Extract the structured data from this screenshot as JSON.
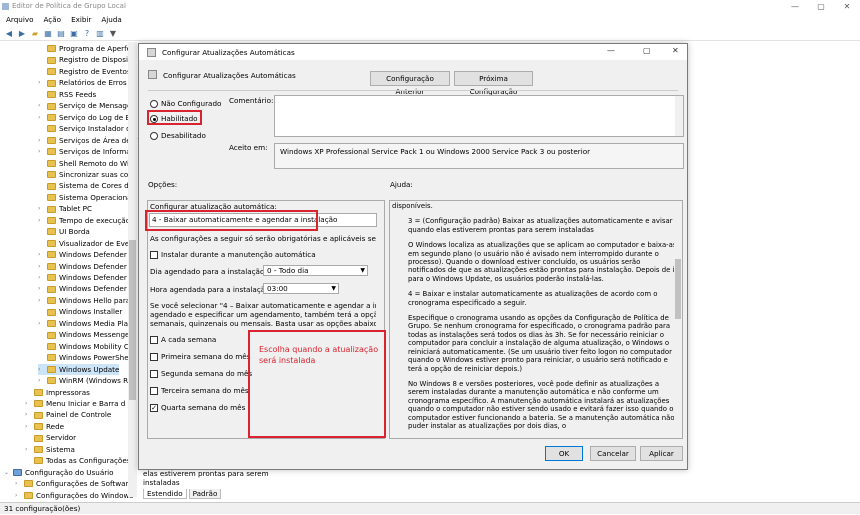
{
  "window": {
    "title": "Editor de Política de Grupo Local",
    "min": "—",
    "max": "▢",
    "close": "✕"
  },
  "menu": [
    "Arquivo",
    "Ação",
    "Exibir",
    "Ajuda"
  ],
  "tree": [
    {
      "label": "Programa de Aperfei",
      "indent": 3
    },
    {
      "label": "Registro de Disposit",
      "indent": 3
    },
    {
      "label": "Registro de Eventos",
      "indent": 3
    },
    {
      "label": "Relatórios de Erros d",
      "indent": 3,
      "expand": true
    },
    {
      "label": "RSS Feeds",
      "indent": 3
    },
    {
      "label": "Serviço de Mensager",
      "indent": 3,
      "expand": true
    },
    {
      "label": "Serviço do Log de Ev",
      "indent": 3,
      "expand": true
    },
    {
      "label": "Serviço Instalador do",
      "indent": 3
    },
    {
      "label": "Serviços de Área de T",
      "indent": 3,
      "expand": true
    },
    {
      "label": "Serviços de Informaç",
      "indent": 3,
      "expand": true
    },
    {
      "label": "Shell Remoto do Win",
      "indent": 3
    },
    {
      "label": "Sincronizar suas conf",
      "indent": 3
    },
    {
      "label": "Sistema de Cores do",
      "indent": 3
    },
    {
      "label": "Sistema Operacional",
      "indent": 3
    },
    {
      "label": "Tablet PC",
      "indent": 3,
      "expand": true
    },
    {
      "label": "Tempo de execução",
      "indent": 3,
      "expand": true
    },
    {
      "label": "UI Borda",
      "indent": 3
    },
    {
      "label": "Visualizador de Event",
      "indent": 3
    },
    {
      "label": "Windows Defender A",
      "indent": 3,
      "expand": true
    },
    {
      "label": "Windows Defender A",
      "indent": 3,
      "expand": true
    },
    {
      "label": "Windows Defender E",
      "indent": 3,
      "expand": true
    },
    {
      "label": "Windows Defender S",
      "indent": 3,
      "expand": true
    },
    {
      "label": "Windows Hello para l",
      "indent": 3,
      "expand": true
    },
    {
      "label": "Windows Installer",
      "indent": 3
    },
    {
      "label": "Windows Media Play",
      "indent": 3,
      "expand": true
    },
    {
      "label": "Windows Messenger",
      "indent": 3
    },
    {
      "label": "Windows Mobility Ce",
      "indent": 3
    },
    {
      "label": "Windows PowerShell",
      "indent": 3
    },
    {
      "label": "Windows Update",
      "indent": 3,
      "selected": true,
      "expand": true
    },
    {
      "label": "WinRM (Windows Re",
      "indent": 3,
      "expand": true
    },
    {
      "label": "Impressoras",
      "indent": 2
    },
    {
      "label": "Menu Iniciar e Barra d",
      "indent": 2,
      "expand": true
    },
    {
      "label": "Painel de Controle",
      "indent": 2,
      "expand": true
    },
    {
      "label": "Rede",
      "indent": 2,
      "expand": true
    },
    {
      "label": "Servidor",
      "indent": 2
    },
    {
      "label": "Sistema",
      "indent": 2,
      "expand": true
    },
    {
      "label": "Todas as Configurações",
      "indent": 2
    },
    {
      "label": "Configuração do Usuário",
      "indent": 0,
      "expand": true,
      "computer": true
    },
    {
      "label": "Configurações de Software",
      "indent": 1,
      "expand": true
    },
    {
      "label": "Configurações do Windows",
      "indent": 1,
      "expand": true
    },
    {
      "label": "Modelos Administrativos",
      "indent": 1,
      "expand": true
    }
  ],
  "behind": {
    "line1": "elas estiverem prontas para serem",
    "line2": "instaladas",
    "tab1": "Estendido",
    "tab2": "Padrão"
  },
  "status": "31 configuração(ões)",
  "dialog": {
    "title": "Configurar Atualizações Automáticas",
    "heading": "Configurar Atualizações Automáticas",
    "prev": "Configuração Anterior",
    "next": "Próxima Configuração",
    "radio_not": "Não Configurado",
    "radio_enabled": "Habilitado",
    "radio_disabled": "Desabilitado",
    "comment_label": "Comentário:",
    "supported_label": "Aceito em:",
    "supported_text": "Windows XP Professional Service Pack 1 ou Windows 2000 Service Pack 3 ou posterior",
    "options_label": "Opções:",
    "help_label": "Ajuda:",
    "opt_title": "Configurar atualização automática:",
    "opt_selected": "4 - Baixar automaticamente e agendar a instalação",
    "opt_note": "As configurações a seguir só serão obrigatórias e aplicáveis se a opção",
    "chk_maint": "Instalar durante a manutenção automática",
    "day_label": "Dia agendado para a instalação:",
    "day_value": "0 - Todo dia",
    "time_label": "Hora agendada para a instalação:",
    "time_value": "03:00",
    "para1": "Se você selecionar \"4 – Baixar automaticamente e agendar a instalação",
    "para2": "agendado e especificar um agendamento, também terá a opção de lim",
    "para3": "semanais, quinzenais ou mensais. Basta usar as opções abaixo:",
    "chk_every": "A cada semana",
    "chk_first": "Primeira semana do mês",
    "chk_second": "Segunda semana do mês",
    "chk_third": "Terceira semana do mês",
    "chk_fourth": "Quarta semana do mês",
    "annotation": "Escolha quando a atualização será instalada",
    "help": [
      "disponíveis.",
      "3 = (Configuração padrão) Baixar as atualizações automaticamente e avisar quando elas estiverem prontas para serem instaladas",
      "O Windows localiza as atualizações que se aplicam ao computador e baixa-as em segundo plano (o usuário não é avisado nem interrompido durante o processo). Quando o download estiver concluído, os usuários serão notificados de que as atualizações estão prontas para instalação. Depois de ir para o Windows Update, os usuários poderão instalá-las.",
      "4 = Baixar e instalar automaticamente as atualizações de acordo com o cronograma especificado a seguir.",
      "Especifique o cronograma usando as opções da Configuração de Política de Grupo. Se nenhum cronograma for especificado, o cronograma padrão para todas as instalações será todos os dias às 3h. Se for necessário reiniciar o computador para concluir a instalação de alguma atualização, o Windows o reiniciará automaticamente. (Se um usuário tiver feito logon no computador quando o Windows estiver pronto para reiniciar, o usuário será notificado e terá a opção de reiniciar depois.)",
      "No Windows 8 e versões posteriores, você pode definir as atualizações a serem instaladas durante a manutenção automática e não conforme um cronograma específico. A manutenção automática instalará as atualizações quando o computador não estiver sendo usado e evitará fazer isso quando o computador estiver funcionando a bateria. Se a manutenção automática não puder instalar as atualizações por dois dias, o"
    ],
    "ok": "OK",
    "cancel": "Cancelar",
    "apply": "Aplicar"
  },
  "colors": {
    "accent": "#d9232f",
    "annotation": "#d9232f"
  }
}
